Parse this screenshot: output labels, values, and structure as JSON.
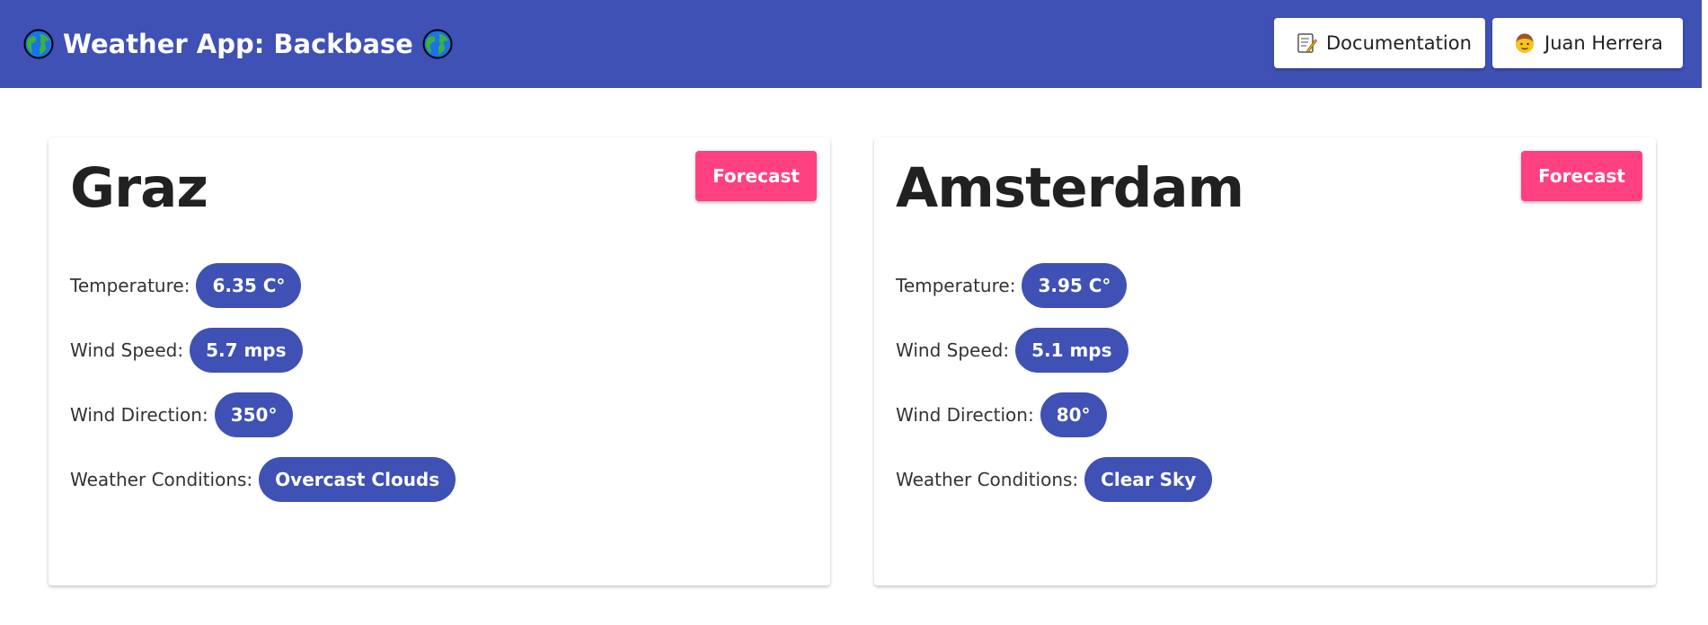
{
  "header": {
    "title": "Weather App: Backbase",
    "background": "#3f51b5",
    "icons": {
      "left": "globe-icon",
      "right": "globe-icon"
    },
    "actions": [
      {
        "label": "Documentation",
        "icon": "memo-icon"
      },
      {
        "label": "Juan Herrera",
        "icon": "avatar-icon"
      }
    ]
  },
  "cities": [
    {
      "name": "Graz",
      "forecast_label": "Forecast",
      "fields": [
        {
          "label": "Temperature:",
          "value": "6.35 C°"
        },
        {
          "label": "Wind Speed:",
          "value": "5.7 mps"
        },
        {
          "label": "Wind Direction:",
          "value": "350°"
        },
        {
          "label": "Weather Conditions:",
          "value": "Overcast Clouds"
        }
      ]
    },
    {
      "name": "Amsterdam",
      "forecast_label": "Forecast",
      "fields": [
        {
          "label": "Temperature:",
          "value": "3.95 C°"
        },
        {
          "label": "Wind Speed:",
          "value": "5.1 mps"
        },
        {
          "label": "Wind Direction:",
          "value": "80°"
        },
        {
          "label": "Weather Conditions:",
          "value": "Clear Sky"
        }
      ]
    }
  ],
  "colors": {
    "primary": "#3f51b5",
    "accent": "#ff4081",
    "text": "#212121"
  }
}
